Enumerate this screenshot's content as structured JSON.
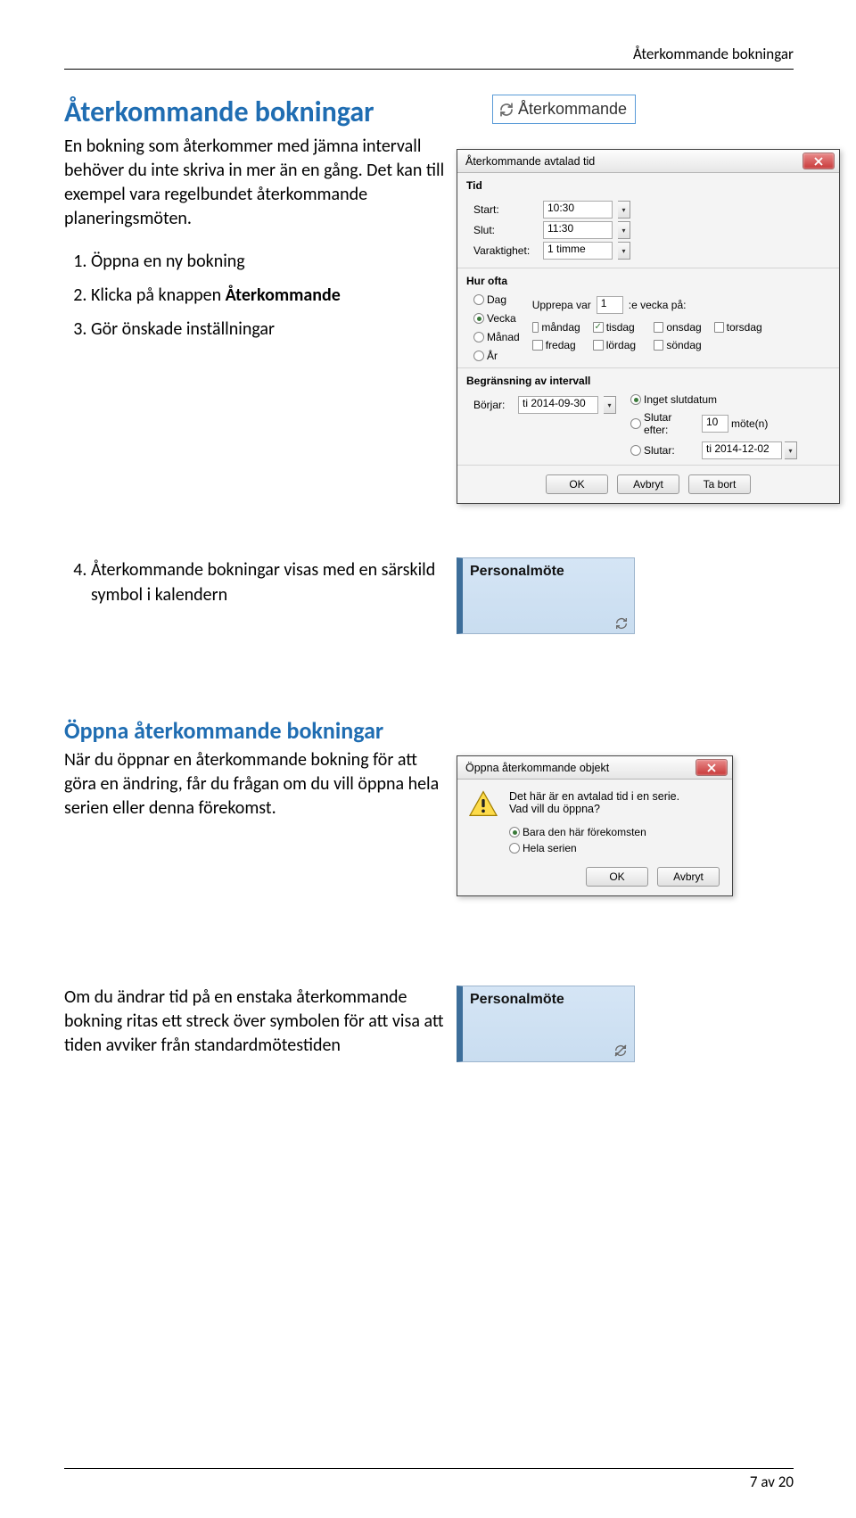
{
  "doc": {
    "header_right": "Återkommande bokningar",
    "page_marker": "7 av 20"
  },
  "section1": {
    "heading": "Återkommande bokningar",
    "intro": "En bokning som återkommer med jämna intervall behöver du inte skriva in mer än en gång. Det kan till exempel vara regelbundet återkommande planeringsmöten.",
    "step1": "Öppna en ny bokning",
    "step2a": "Klicka på knappen ",
    "step2b": "Återkommande",
    "step3": "Gör önskade inställningar",
    "recur_button_label": "Återkommande"
  },
  "dlg_recur": {
    "title": "Återkommande avtalad tid",
    "grp1": "Tid",
    "start_lbl": "Start:",
    "start_val": "10:30",
    "slut_lbl": "Slut:",
    "slut_val": "11:30",
    "dur_lbl": "Varaktighet:",
    "dur_val": "1 timme",
    "grp2": "Hur ofta",
    "dag": "Dag",
    "vecka": "Vecka",
    "manad": "Månad",
    "ar": "År",
    "upprepa_pre": "Upprepa var",
    "upprepa_val": "1",
    "upprepa_post": ":e vecka på:",
    "d_mon": "måndag",
    "d_tis": "tisdag",
    "d_ons": "onsdag",
    "d_tor": "torsdag",
    "d_fre": "fredag",
    "d_lor": "lördag",
    "d_son": "söndag",
    "grp3": "Begränsning av intervall",
    "borjar_lbl": "Börjar:",
    "borjar_val": "ti 2014-09-30",
    "nolimit": "Inget slutdatum",
    "efter_lbl": "Slutar efter:",
    "efter_val": "10",
    "efter_unit": "möte(n)",
    "slutar_lbl": "Slutar:",
    "slutar_val": "ti 2014-12-02",
    "ok": "OK",
    "avbryt": "Avbryt",
    "tabort": "Ta bort"
  },
  "step4": "Återkommande bokningar visas med en särskild symbol i kalendern",
  "cal_tile_title": "Personalmöte",
  "section2": {
    "heading": "Öppna återkommande bokningar",
    "para": "När du öppnar en återkommande bokning för att göra en ändring, får du frågan om du vill öppna hela serien eller denna förekomst."
  },
  "dlg_open": {
    "title": "Öppna återkommande objekt",
    "msg1": "Det här är en avtalad tid i en serie.",
    "msg2": "Vad vill du öppna?",
    "opt1": "Bara den här förekomsten",
    "opt2": "Hela serien",
    "ok": "OK",
    "avbryt": "Avbryt"
  },
  "section3": {
    "para": "Om du ändrar tid på en enstaka återkommande bokning ritas ett streck över symbolen för att visa att tiden avviker från standardmötestiden"
  }
}
